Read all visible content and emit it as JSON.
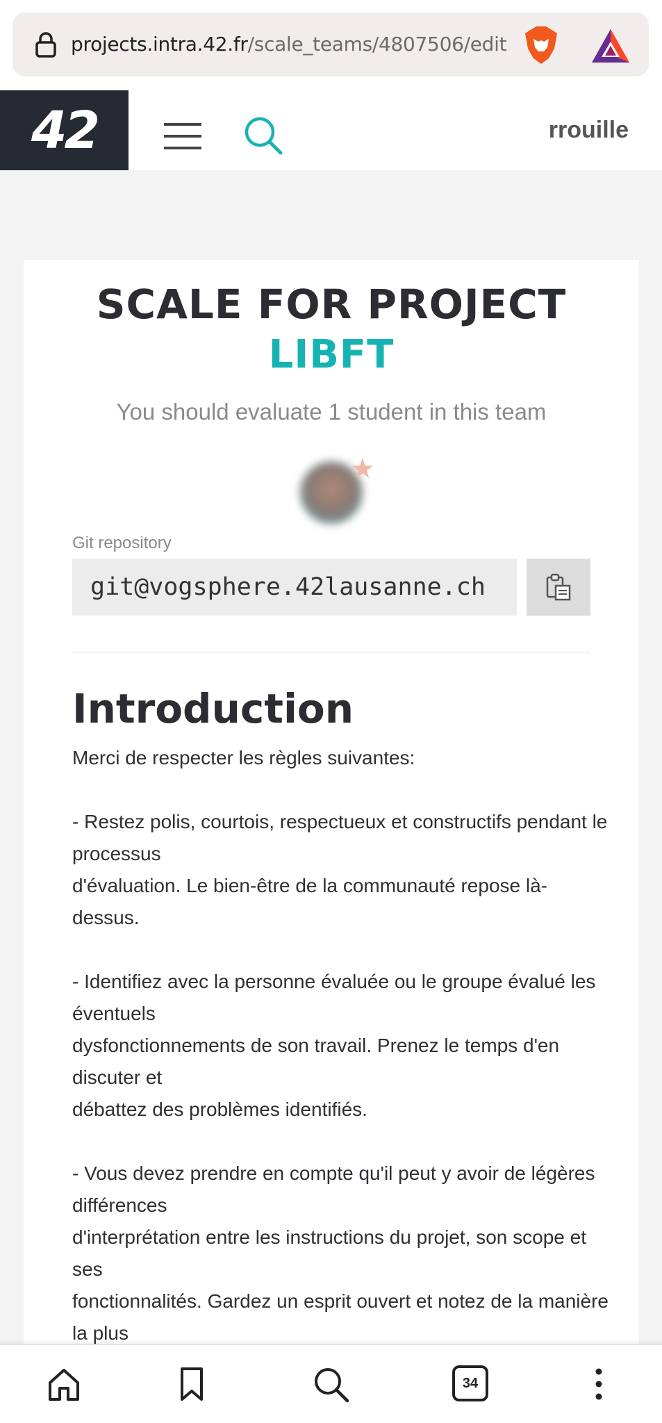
{
  "browser": {
    "url_host": "projects.intra.42.fr",
    "url_path": "/scale_teams/4807506/edit",
    "icons": [
      "lock-icon",
      "brave-lion-icon",
      "bat-triangle-icon"
    ]
  },
  "header": {
    "logo": "42",
    "username": "rrouille",
    "icons": [
      "hamburger-menu-icon",
      "search-icon"
    ],
    "accent_color": "#17b3b3"
  },
  "scale": {
    "title": "SCALE FOR PROJECT",
    "project": "LIBFT",
    "evaluate_text": "You should evaluate 1 student in this team",
    "git_label": "Git repository",
    "git_value": "git@vogsphere.42lausanne.ch",
    "copy_icon": "clipboard-icon"
  },
  "introduction": {
    "title": "Introduction",
    "lines": [
      "Merci de respecter les règles suivantes:",
      "",
      "- Restez polis, courtois, respectueux et constructifs pendant le processus",
      "d'évaluation. Le bien-être de la communauté repose là-dessus.",
      "",
      "- Identifiez avec la personne évaluée ou le groupe évalué les éventuels",
      "dysfonctionnements de son travail. Prenez le temps d'en discuter et",
      "débattez des problèmes identifiés.",
      "",
      "- Vous devez prendre en compte qu'il peut y avoir de légères différences",
      "d'interprétation entre les instructions du projet, son scope et ses",
      "fonctionnalités. Gardez un esprit ouvert et notez de la manière la plus"
    ]
  },
  "bottom_nav": {
    "items": [
      "home-icon",
      "bookmark-icon",
      "search-icon",
      "tabs-icon",
      "more-icon"
    ],
    "tabs_count": "34"
  }
}
